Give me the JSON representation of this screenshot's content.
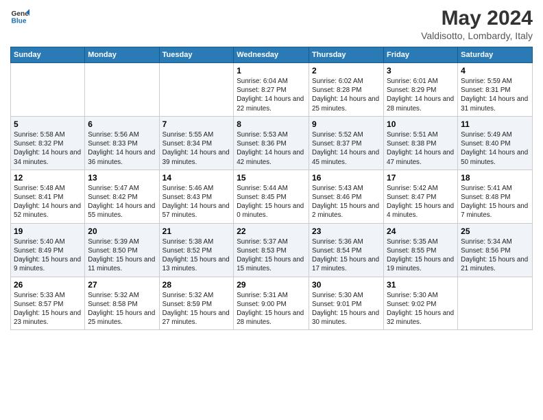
{
  "header": {
    "logo_line1": "General",
    "logo_line2": "Blue",
    "title": "May 2024",
    "subtitle": "Valdisotto, Lombardy, Italy"
  },
  "days_of_week": [
    "Sunday",
    "Monday",
    "Tuesday",
    "Wednesday",
    "Thursday",
    "Friday",
    "Saturday"
  ],
  "weeks": [
    [
      {
        "day": "",
        "sunrise": "",
        "sunset": "",
        "daylight": ""
      },
      {
        "day": "",
        "sunrise": "",
        "sunset": "",
        "daylight": ""
      },
      {
        "day": "",
        "sunrise": "",
        "sunset": "",
        "daylight": ""
      },
      {
        "day": "1",
        "sunrise": "Sunrise: 6:04 AM",
        "sunset": "Sunset: 8:27 PM",
        "daylight": "Daylight: 14 hours and 22 minutes."
      },
      {
        "day": "2",
        "sunrise": "Sunrise: 6:02 AM",
        "sunset": "Sunset: 8:28 PM",
        "daylight": "Daylight: 14 hours and 25 minutes."
      },
      {
        "day": "3",
        "sunrise": "Sunrise: 6:01 AM",
        "sunset": "Sunset: 8:29 PM",
        "daylight": "Daylight: 14 hours and 28 minutes."
      },
      {
        "day": "4",
        "sunrise": "Sunrise: 5:59 AM",
        "sunset": "Sunset: 8:31 PM",
        "daylight": "Daylight: 14 hours and 31 minutes."
      }
    ],
    [
      {
        "day": "5",
        "sunrise": "Sunrise: 5:58 AM",
        "sunset": "Sunset: 8:32 PM",
        "daylight": "Daylight: 14 hours and 34 minutes."
      },
      {
        "day": "6",
        "sunrise": "Sunrise: 5:56 AM",
        "sunset": "Sunset: 8:33 PM",
        "daylight": "Daylight: 14 hours and 36 minutes."
      },
      {
        "day": "7",
        "sunrise": "Sunrise: 5:55 AM",
        "sunset": "Sunset: 8:34 PM",
        "daylight": "Daylight: 14 hours and 39 minutes."
      },
      {
        "day": "8",
        "sunrise": "Sunrise: 5:53 AM",
        "sunset": "Sunset: 8:36 PM",
        "daylight": "Daylight: 14 hours and 42 minutes."
      },
      {
        "day": "9",
        "sunrise": "Sunrise: 5:52 AM",
        "sunset": "Sunset: 8:37 PM",
        "daylight": "Daylight: 14 hours and 45 minutes."
      },
      {
        "day": "10",
        "sunrise": "Sunrise: 5:51 AM",
        "sunset": "Sunset: 8:38 PM",
        "daylight": "Daylight: 14 hours and 47 minutes."
      },
      {
        "day": "11",
        "sunrise": "Sunrise: 5:49 AM",
        "sunset": "Sunset: 8:40 PM",
        "daylight": "Daylight: 14 hours and 50 minutes."
      }
    ],
    [
      {
        "day": "12",
        "sunrise": "Sunrise: 5:48 AM",
        "sunset": "Sunset: 8:41 PM",
        "daylight": "Daylight: 14 hours and 52 minutes."
      },
      {
        "day": "13",
        "sunrise": "Sunrise: 5:47 AM",
        "sunset": "Sunset: 8:42 PM",
        "daylight": "Daylight: 14 hours and 55 minutes."
      },
      {
        "day": "14",
        "sunrise": "Sunrise: 5:46 AM",
        "sunset": "Sunset: 8:43 PM",
        "daylight": "Daylight: 14 hours and 57 minutes."
      },
      {
        "day": "15",
        "sunrise": "Sunrise: 5:44 AM",
        "sunset": "Sunset: 8:45 PM",
        "daylight": "Daylight: 15 hours and 0 minutes."
      },
      {
        "day": "16",
        "sunrise": "Sunrise: 5:43 AM",
        "sunset": "Sunset: 8:46 PM",
        "daylight": "Daylight: 15 hours and 2 minutes."
      },
      {
        "day": "17",
        "sunrise": "Sunrise: 5:42 AM",
        "sunset": "Sunset: 8:47 PM",
        "daylight": "Daylight: 15 hours and 4 minutes."
      },
      {
        "day": "18",
        "sunrise": "Sunrise: 5:41 AM",
        "sunset": "Sunset: 8:48 PM",
        "daylight": "Daylight: 15 hours and 7 minutes."
      }
    ],
    [
      {
        "day": "19",
        "sunrise": "Sunrise: 5:40 AM",
        "sunset": "Sunset: 8:49 PM",
        "daylight": "Daylight: 15 hours and 9 minutes."
      },
      {
        "day": "20",
        "sunrise": "Sunrise: 5:39 AM",
        "sunset": "Sunset: 8:50 PM",
        "daylight": "Daylight: 15 hours and 11 minutes."
      },
      {
        "day": "21",
        "sunrise": "Sunrise: 5:38 AM",
        "sunset": "Sunset: 8:52 PM",
        "daylight": "Daylight: 15 hours and 13 minutes."
      },
      {
        "day": "22",
        "sunrise": "Sunrise: 5:37 AM",
        "sunset": "Sunset: 8:53 PM",
        "daylight": "Daylight: 15 hours and 15 minutes."
      },
      {
        "day": "23",
        "sunrise": "Sunrise: 5:36 AM",
        "sunset": "Sunset: 8:54 PM",
        "daylight": "Daylight: 15 hours and 17 minutes."
      },
      {
        "day": "24",
        "sunrise": "Sunrise: 5:35 AM",
        "sunset": "Sunset: 8:55 PM",
        "daylight": "Daylight: 15 hours and 19 minutes."
      },
      {
        "day": "25",
        "sunrise": "Sunrise: 5:34 AM",
        "sunset": "Sunset: 8:56 PM",
        "daylight": "Daylight: 15 hours and 21 minutes."
      }
    ],
    [
      {
        "day": "26",
        "sunrise": "Sunrise: 5:33 AM",
        "sunset": "Sunset: 8:57 PM",
        "daylight": "Daylight: 15 hours and 23 minutes."
      },
      {
        "day": "27",
        "sunrise": "Sunrise: 5:32 AM",
        "sunset": "Sunset: 8:58 PM",
        "daylight": "Daylight: 15 hours and 25 minutes."
      },
      {
        "day": "28",
        "sunrise": "Sunrise: 5:32 AM",
        "sunset": "Sunset: 8:59 PM",
        "daylight": "Daylight: 15 hours and 27 minutes."
      },
      {
        "day": "29",
        "sunrise": "Sunrise: 5:31 AM",
        "sunset": "Sunset: 9:00 PM",
        "daylight": "Daylight: 15 hours and 28 minutes."
      },
      {
        "day": "30",
        "sunrise": "Sunrise: 5:30 AM",
        "sunset": "Sunset: 9:01 PM",
        "daylight": "Daylight: 15 hours and 30 minutes."
      },
      {
        "day": "31",
        "sunrise": "Sunrise: 5:30 AM",
        "sunset": "Sunset: 9:02 PM",
        "daylight": "Daylight: 15 hours and 32 minutes."
      },
      {
        "day": "",
        "sunrise": "",
        "sunset": "",
        "daylight": ""
      }
    ]
  ]
}
